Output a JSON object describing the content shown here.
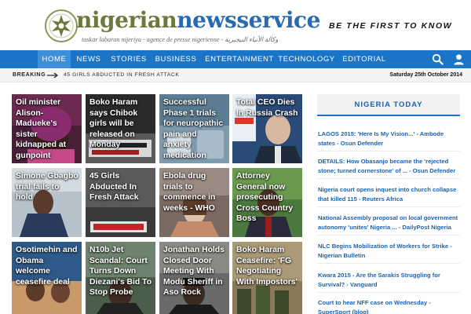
{
  "header": {
    "logo_part1": "nigerian",
    "logo_part2": "newsservice",
    "tagline": "taskar labaran nijeriya - agence de presse nigerienne - وكالة الأنباء النيجيرية",
    "slogan": "BE THE FIRST TO KNOW"
  },
  "nav": {
    "items": [
      "HOME",
      "NEWS",
      "STORIES",
      "BUSINESS",
      "ENTERTAINMENT",
      "TECHNOLOGY",
      "EDITORIAL"
    ],
    "active": "HOME",
    "icons": [
      "search-icon",
      "user-icon"
    ]
  },
  "breaking": {
    "label": "BREAKING",
    "headline": "45 GIRLS ABDUCTED IN FRESH ATTACK",
    "date": "Saturday 25th October 2014"
  },
  "tiles": [
    {
      "title": "Oil minister Alison-Madueke's sister kidnapped at gunpoint"
    },
    {
      "title": "Boko Haram says Chibok girls will be released on Monday"
    },
    {
      "title": "Successful Phase 1 trials for neuropathic pain and anxiety medication"
    },
    {
      "title": "Total CEO Dies In Russia Crash"
    },
    {
      "title": "Simone Gbagbo trial fails to hold"
    },
    {
      "title": "45 Girls Abducted In Fresh Attack"
    },
    {
      "title": "Ebola drug trials to commence in weeks - WHO"
    },
    {
      "title": "Attorney General now prosecuting Cross Country Boss"
    },
    {
      "title": "Osotimehin and Obama welcome ceasefire deal"
    },
    {
      "title": "N10b Jet Scandal: Court Turns Down Diezani's Bid To Stop Probe"
    },
    {
      "title": "Jonathan Holds Closed Door Meeting With Modu Sheriff in Aso Rock"
    },
    {
      "title": "Boko Haram Ceasefire: 'FG Negotiating With Impostors'"
    }
  ],
  "sidebar": {
    "title": "NIGERIA TODAY",
    "links": [
      "LAGOS 2015: 'Here Is My Vision...' - Ambode states - Osun Defender",
      "DETAILS: How Obasanjo became the 'rejected stone; turned cornerstone' of ... - Osun Defender",
      "Nigeria court opens inquest into church collapse that killed 115 - Reuters Africa",
      "National Assembly proposal on local government autonomy 'unites' Nigeria ... - DailyPost Nigeria",
      "NLC Begins Mobilization of Workers for Strike - Nigerian Bulletin",
      "Kwara 2015 - Are the Sarakis Struggling for Survival? - Vanguard",
      "Court to hear NFF case on Wednesday - SuperSport (blog)"
    ]
  },
  "colors": {
    "nav_blue": "#1a75c8",
    "nav_active": "#3d8fdb",
    "link_blue": "#1a62b0",
    "logo_olive": "#6b7a3c"
  }
}
